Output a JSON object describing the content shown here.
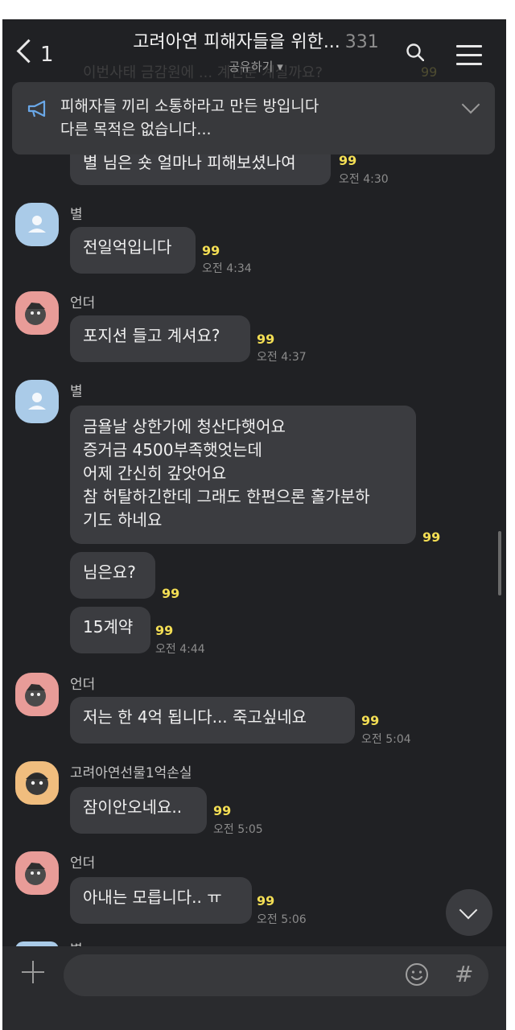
{
  "header": {
    "back_count": "1",
    "title": "고려아연 피해자들을 위한...",
    "member_count": "331",
    "share_label": "공유하기 ▾"
  },
  "behind_header": {
    "text": "이번사태  금감원에 ...  계신분 계실까요?",
    "unread": "99"
  },
  "notice": {
    "line1": "피해자들 끼리  소통하라고 만든 방입니다",
    "line2": "다른 목적은 없습니다..."
  },
  "messages": [
    {
      "text": "별 님은 숏 얼마나 피해보셨나여",
      "unread": "99",
      "time": "오전 4:30"
    },
    {
      "sender": "별",
      "text": "전일억입니다",
      "unread": "99",
      "time": "오전 4:34"
    },
    {
      "sender": "언더",
      "text": "포지션 들고 계셔요?",
      "unread": "99",
      "time": "오전 4:37"
    },
    {
      "sender": "별",
      "lines": [
        "금욜날 상한가에 청산다햇어요",
        "증거금 4500부족햇엇는데",
        "어제 간신히 갚앗어요",
        "참 허탈하긴한데 그래도 한편으론 홀가분하",
        "기도 하네요"
      ],
      "unread": "99"
    },
    {
      "text": "님은요?",
      "unread": "99"
    },
    {
      "text": "15계약",
      "unread": "99",
      "time": "오전 4:44"
    },
    {
      "sender": "언더",
      "text": "저는 한 4억 됩니다... 죽고싶네요",
      "unread": "99",
      "time": "오전 5:04"
    },
    {
      "sender": "고려아연선물1억손실",
      "text": "잠이안오네요..",
      "unread": "99",
      "time": "오전 5:05"
    },
    {
      "sender": "언더",
      "text": "아내는 모릅니다.. ㅠ",
      "unread": "99",
      "time": "오전 5:06"
    },
    {
      "sender": "별"
    }
  ],
  "colors": {
    "background": "#202124",
    "bubble": "#3b3c40",
    "unread": "#f3de54",
    "avatar_default": "#aacbe8"
  },
  "icons": [
    "back-chevron-icon",
    "search-icon",
    "menu-icon",
    "megaphone-icon",
    "chevron-down-icon",
    "plus-icon",
    "emoji-icon",
    "hash-icon"
  ]
}
